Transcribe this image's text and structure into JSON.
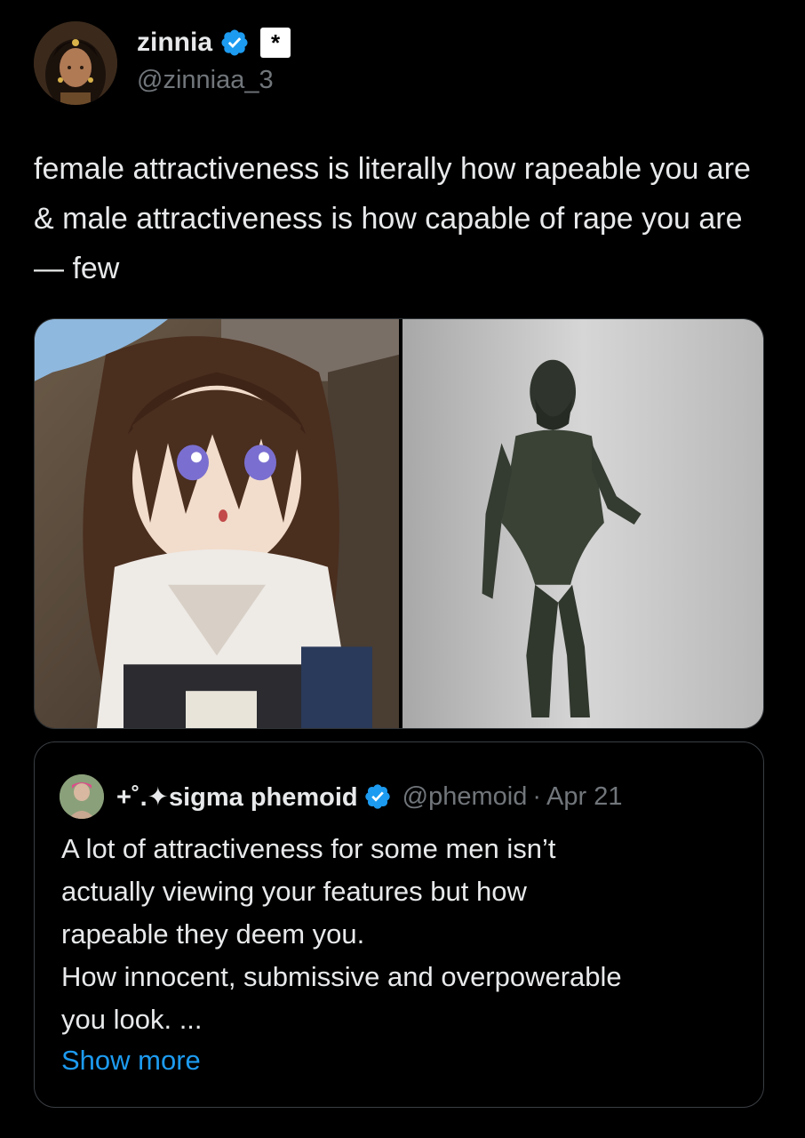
{
  "author": {
    "display_name": "zinnia",
    "handle": "@zinniaa_3",
    "verified_icon": "verified-badge-icon",
    "affiliation_icon": "asterisk-badge-icon",
    "affiliation_glyph": "*"
  },
  "tweet": {
    "text": "female attractiveness is literally how rapeable you are & male attractiveness is how capable of rape you are— few"
  },
  "media": {
    "images": [
      {
        "name": "anime-girl-image"
      },
      {
        "name": "bronze-statue-image"
      }
    ]
  },
  "quoted_tweet": {
    "display_name": "+˚.✦sigma phemoid",
    "handle": "@phemoid",
    "separator": "·",
    "date": "Apr 21",
    "text": "A lot of attractiveness for some men isn’t\nactually viewing your features but how\nrapeable they deem you.\nHow innocent, submissive and overpowerable\nyou look. ...",
    "show_more": "Show more"
  },
  "colors": {
    "background": "#000000",
    "text": "#e7e9ea",
    "secondary": "#71767b",
    "link": "#1d9bf0",
    "verified": "#1d9bf0",
    "border": "#2f3336"
  }
}
